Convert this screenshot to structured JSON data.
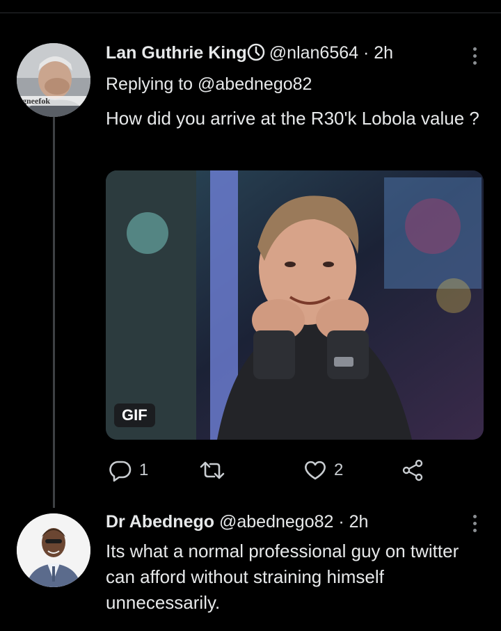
{
  "tweets": [
    {
      "author_name": "Lan Guthrie King",
      "handle": "@nlan6564",
      "separator": "·",
      "time": "2h",
      "replying_to": "Replying to @abednego82",
      "text": "How did you arrive at the R30'k Lobola value ?",
      "avatar_watermark": "agneefok",
      "media_badge": "GIF",
      "reply_count": "1",
      "like_count": "2"
    },
    {
      "author_name": "Dr Abednego",
      "handle": "@abednego82",
      "separator": "·",
      "time": "2h",
      "text": "Its what a normal professional guy on twitter can afford without straining himself unnecessarily."
    }
  ],
  "icons": {
    "verified": "verified-badge-icon",
    "more": "more-vertical-icon",
    "reply": "reply-icon",
    "retweet": "retweet-icon",
    "like": "heart-icon",
    "share": "share-icon"
  },
  "colors": {
    "background": "#000000",
    "text": "#e7e9ea",
    "icon": "#c9cdd1",
    "thread_line": "#3e4144"
  }
}
